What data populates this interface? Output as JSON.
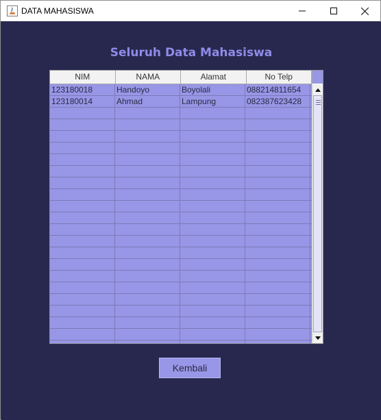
{
  "window": {
    "title": "DATA MAHASISWA",
    "controls": [
      "minimize-button",
      "maximize-button",
      "close-button"
    ]
  },
  "heading": "Seluruh Data Mahasiswa",
  "table": {
    "columns": [
      "NIM",
      "NAMA",
      "Alamat",
      "No Telp"
    ],
    "rows": [
      [
        "123180018",
        "Handoyo",
        "Boyolali",
        "088214811654"
      ],
      [
        "123180014",
        "Ahmad",
        "Lampung",
        "082387623428"
      ]
    ],
    "empty_row_count": 21
  },
  "back_button": "Kembali",
  "colors": {
    "background": "#28284f",
    "accent": "#9896e6",
    "heading": "#8f8ce8"
  }
}
